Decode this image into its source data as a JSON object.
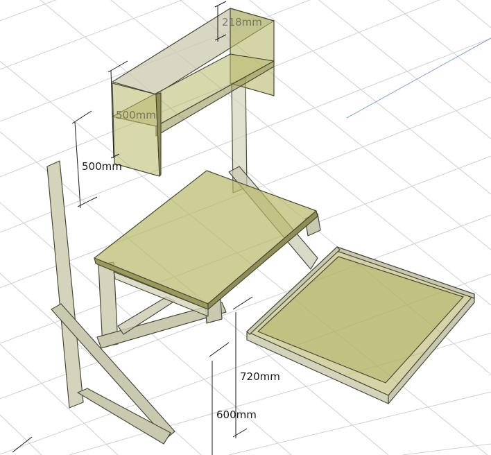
{
  "dimensions": {
    "shelf_height": "218mm",
    "hutch_height": "500mm",
    "side_height": "500mm",
    "desk_height": "720mm",
    "seat_height": "600mm"
  },
  "colors": {
    "panel_fill": "#b8b86a",
    "panel_stroke": "#4a4a3a",
    "wood_fill": "#c9c9b0",
    "grid_line": "#cfcfcf",
    "background": "#ffffff"
  }
}
